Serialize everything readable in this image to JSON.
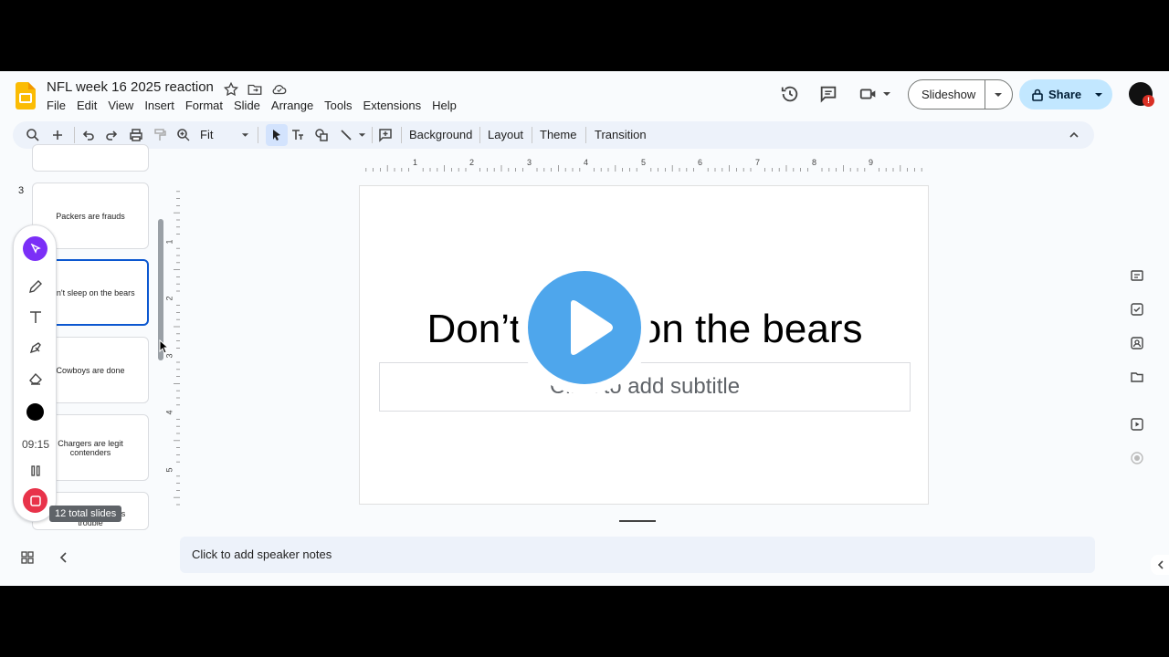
{
  "header": {
    "title": "NFL week 16 2025 reaction",
    "menus": [
      "File",
      "Edit",
      "View",
      "Insert",
      "Format",
      "Slide",
      "Arrange",
      "Tools",
      "Extensions",
      "Help"
    ],
    "slideshow_label": "Slideshow",
    "share_label": "Share",
    "avatar_badge": "!"
  },
  "toolbar": {
    "zoom": "Fit",
    "background_label": "Background",
    "layout_label": "Layout",
    "theme_label": "Theme",
    "transition_label": "Transition"
  },
  "filmstrip": {
    "slide_number": "3",
    "thumbs": [
      "Packers are frauds",
      "Don't sleep on the bears",
      "Cowboys are done",
      "Chargers are legit contenders",
      "Bucs are in serious trouble"
    ]
  },
  "drawpanel": {
    "timer": "09:15",
    "tooltip": "12 total slides"
  },
  "slide": {
    "title": "Don’t sleep on the bears",
    "subtitle_placeholder": "Click to add subtitle"
  },
  "ruler": {
    "h_labels": [
      "1",
      "2",
      "3",
      "4",
      "5",
      "6",
      "7",
      "8",
      "9"
    ],
    "v_labels": [
      "1",
      "2",
      "3",
      "4",
      "5"
    ]
  },
  "notes": {
    "placeholder": "Click to add speaker notes"
  },
  "colors": {
    "accent": "#0b57d0",
    "share_bg": "#c2e7ff",
    "cursor_tool": "#7b2ff7",
    "record": "#e8334a",
    "play": "#4ea6ec"
  }
}
